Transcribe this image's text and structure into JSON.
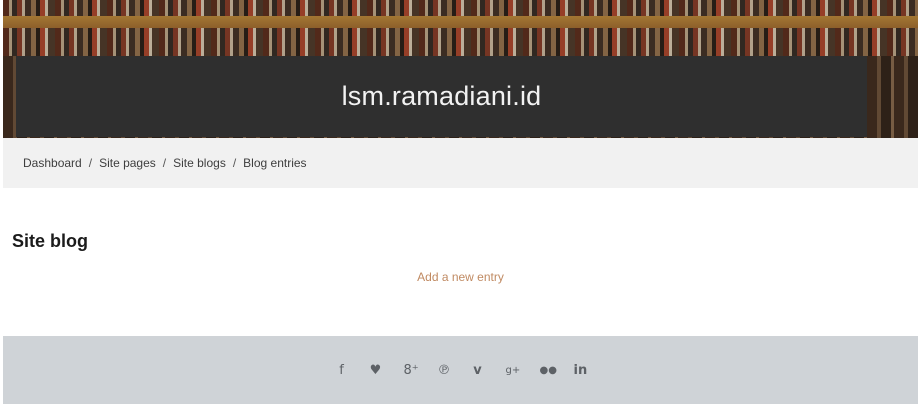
{
  "site": {
    "title": "lsm.ramadiani.id"
  },
  "breadcrumb": [
    {
      "label": "Dashboard"
    },
    {
      "label": "Site pages"
    },
    {
      "label": "Site blogs"
    },
    {
      "label": "Blog entries"
    }
  ],
  "breadcrumb_separator": "/",
  "main": {
    "heading": "Site blog",
    "add_entry_label": "Add a new entry"
  },
  "footer": {
    "social": [
      {
        "icon": "facebook-icon",
        "glyph": "f"
      },
      {
        "icon": "twitter-icon",
        "glyph": "♥"
      },
      {
        "icon": "google-plus-icon",
        "glyph": "8⁺"
      },
      {
        "icon": "pinterest-icon",
        "glyph": "℗"
      },
      {
        "icon": "vimeo-icon",
        "glyph": "v"
      },
      {
        "icon": "google-icon",
        "glyph": "g+"
      },
      {
        "icon": "flickr-icon",
        "glyph": "●●"
      },
      {
        "icon": "linkedin-icon",
        "glyph": "in"
      }
    ]
  },
  "colors": {
    "title_bar": "#2f2f2f",
    "breadcrumb_bg": "#f1f1f1",
    "link_accent": "#c08a62",
    "footer_bg": "#cfd3d7"
  }
}
